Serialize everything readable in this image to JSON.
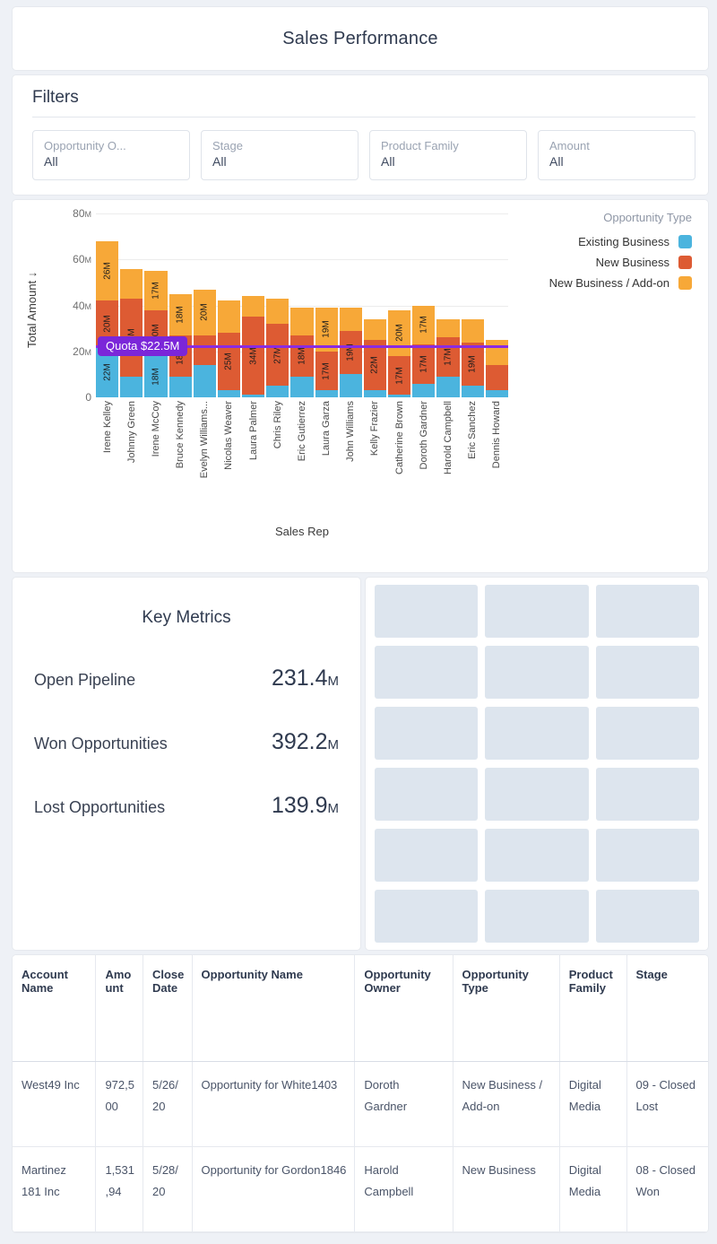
{
  "header": {
    "title": "Sales Performance"
  },
  "filters": {
    "section_title": "Filters",
    "items": [
      {
        "label": "Opportunity O...",
        "value": "All"
      },
      {
        "label": "Stage",
        "value": "All"
      },
      {
        "label": "Product Family",
        "value": "All"
      },
      {
        "label": "Amount",
        "value": "All"
      }
    ]
  },
  "chart_data": {
    "type": "bar",
    "subtype": "stacked-vertical",
    "title": "",
    "xlabel": "Sales Rep",
    "ylabel": "Total Amount ↓",
    "ylim": [
      0,
      80
    ],
    "yticks": [
      "0",
      "20",
      "40",
      "60",
      "80"
    ],
    "ytick_suffix": "M",
    "grid": true,
    "legend_title": "Opportunity Type",
    "legend_position": "top-right",
    "categories": [
      "Irene Kelley",
      "Johnny Green",
      "Irene McCoy",
      "Bruce Kennedy",
      "Evelyn Williams...",
      "Nicolas Weaver",
      "Laura Palmer",
      "Chris Riley",
      "Eric Gutierrez",
      "Laura Garza",
      "John Williams",
      "Kelly Frazier",
      "Catherine Brown",
      "Doroth Gardner",
      "Harold Campbell",
      "Eric Sanchez",
      "Dennis Howard"
    ],
    "series": [
      {
        "name": "Existing Business",
        "color": "#4BB4DE",
        "values": [
          22,
          9,
          18,
          9,
          14,
          3,
          1,
          5,
          9,
          3,
          10,
          3,
          1,
          6,
          9,
          5,
          3
        ],
        "labels": [
          "22M",
          "",
          "18M",
          "",
          "",
          "",
          "",
          "",
          "",
          "",
          "",
          "",
          "",
          "",
          "",
          "",
          ""
        ]
      },
      {
        "name": "New Business",
        "color": "#DD5B33",
        "values": [
          20,
          34,
          20,
          18,
          13,
          25,
          34,
          27,
          18,
          17,
          19,
          22,
          17,
          17,
          17,
          19,
          11
        ],
        "labels": [
          "20M",
          "34M",
          "20M",
          "18M",
          "",
          "25M",
          "34M",
          "27M",
          "18M",
          "17M",
          "19M",
          "22M",
          "17M",
          "17M",
          "17M",
          "19M",
          ""
        ]
      },
      {
        "name": "New Business / Add-on",
        "color": "#F7A838",
        "values": [
          26,
          13,
          17,
          18,
          20,
          14,
          9,
          11,
          12,
          19,
          10,
          9,
          20,
          17,
          8,
          10,
          11
        ],
        "labels": [
          "26M",
          "",
          "17M",
          "18M",
          "20M",
          "",
          "",
          "",
          "",
          "19M",
          "",
          "",
          "20M",
          "17M",
          "",
          "",
          ""
        ]
      }
    ],
    "reference_line": {
      "label": "Quota $22.5M",
      "value": 22.5,
      "color": "#8A2BE2",
      "badge_color": "#7B26D9"
    }
  },
  "metrics": {
    "title": "Key Metrics",
    "rows": [
      {
        "name": "Open Pipeline",
        "value": "231.4",
        "suffix": "M"
      },
      {
        "name": "Won Opportunities",
        "value": "392.2",
        "suffix": "M"
      },
      {
        "name": "Lost Opportunities",
        "value": "139.9",
        "suffix": "M"
      }
    ]
  },
  "skeleton": {
    "columns": 3,
    "rows": 6
  },
  "table": {
    "columns": [
      "Account Name",
      "Amount",
      "Close Date",
      "Opportunity Name",
      "Opportunity Owner",
      "Opportunity Type",
      "Product Family",
      "Stage"
    ],
    "rows": [
      {
        "account_name": "West49 Inc",
        "amount": "972,500",
        "close_date": "5/26/20",
        "opportunity_name": "Opportunity for White1403",
        "opportunity_owner": "Doroth Gardner",
        "opportunity_type": "New Business / Add-on",
        "product_family": "Digital Media",
        "stage": "09 - Closed Lost"
      },
      {
        "account_name": "Martinez 181 Inc",
        "amount": "1,531,94",
        "close_date": "5/28/20",
        "opportunity_name": "Opportunity for Gordon1846",
        "opportunity_owner": "Harold Campbell",
        "opportunity_type": "New Business",
        "product_family": "Digital Media",
        "stage": "08 - Closed Won"
      }
    ]
  }
}
